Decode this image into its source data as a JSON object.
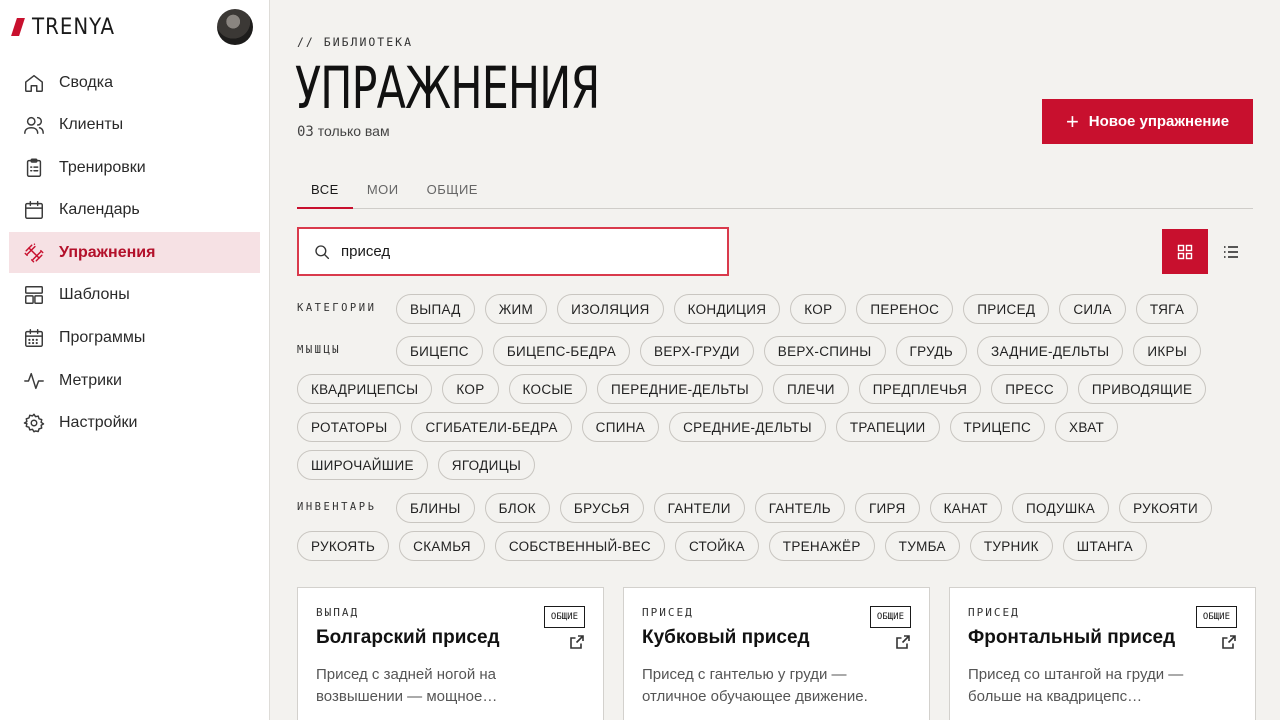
{
  "app": {
    "name": "TRENYA"
  },
  "sidebar": {
    "items": [
      {
        "label": "Сводка",
        "icon": "home-icon"
      },
      {
        "label": "Клиенты",
        "icon": "users-icon"
      },
      {
        "label": "Тренировки",
        "icon": "clipboard-icon"
      },
      {
        "label": "Календарь",
        "icon": "calendar-icon"
      },
      {
        "label": "Упражнения",
        "icon": "dumbbell-icon",
        "active": true
      },
      {
        "label": "Шаблоны",
        "icon": "layout-icon"
      },
      {
        "label": "Программы",
        "icon": "calendar-grid-icon"
      },
      {
        "label": "Метрики",
        "icon": "activity-icon"
      },
      {
        "label": "Настройки",
        "icon": "gear-icon"
      }
    ]
  },
  "header": {
    "eyebrow": "// БИБЛИОТЕКА",
    "title": "УПРАЖНЕНИЯ",
    "count": "03",
    "count_suffix": "только вам",
    "new_button": "Новое упражнение"
  },
  "tabs": [
    {
      "label": "ВСЕ",
      "active": true
    },
    {
      "label": "МОИ"
    },
    {
      "label": "ОБЩИЕ"
    }
  ],
  "search": {
    "value": "присед"
  },
  "filters": {
    "categories_label": "КАТЕГОРИИ",
    "categories": [
      "ВЫПАД",
      "ЖИМ",
      "ИЗОЛЯЦИЯ",
      "КОНДИЦИЯ",
      "КОР",
      "ПЕРЕНОС",
      "ПРИСЕД",
      "СИЛА",
      "ТЯГА"
    ],
    "muscles_label": "МЫШЦЫ",
    "muscles": [
      "БИЦЕПС",
      "БИЦЕПС-БЕДРА",
      "ВЕРХ-ГРУДИ",
      "ВЕРХ-СПИНЫ",
      "ГРУДЬ",
      "ЗАДНИЕ-ДЕЛЬТЫ",
      "ИКРЫ",
      "КВАДРИЦЕПСЫ",
      "КОР",
      "КОСЫЕ",
      "ПЕРЕДНИЕ-ДЕЛЬТЫ",
      "ПЛЕЧИ",
      "ПРЕДПЛЕЧЬЯ",
      "ПРЕСС",
      "ПРИВОДЯЩИЕ",
      "РОТАТОРЫ",
      "СГИБАТЕЛИ-БЕДРА",
      "СПИНА",
      "СРЕДНИЕ-ДЕЛЬТЫ",
      "ТРАПЕЦИИ",
      "ТРИЦЕПС",
      "ХВАТ",
      "ШИРОЧАЙШИЕ",
      "ЯГОДИЦЫ"
    ],
    "equipment_label": "ИНВЕНТАРЬ",
    "equipment": [
      "БЛИНЫ",
      "БЛОК",
      "БРУСЬЯ",
      "ГАНТЕЛИ",
      "ГАНТЕЛЬ",
      "ГИРЯ",
      "КАНАТ",
      "ПОДУШКА",
      "РУКОЯТИ",
      "РУКОЯТЬ",
      "СКАМЬЯ",
      "СОБСТВЕННЫЙ-ВЕС",
      "СТОЙКА",
      "ТРЕНАЖЁР",
      "ТУМБА",
      "ТУРНИК",
      "ШТАНГА"
    ]
  },
  "cards": [
    {
      "category": "ВЫПАД",
      "badge": "ОБЩИЕ",
      "title": "Болгарский присед",
      "desc": "Присед с задней ногой на возвышении — мощное…"
    },
    {
      "category": "ПРИСЕД",
      "badge": "ОБЩИЕ",
      "title": "Кубковый присед",
      "desc": "Присед с гантелью у груди — отличное обучающее движение."
    },
    {
      "category": "ПРИСЕД",
      "badge": "ОБЩИЕ",
      "title": "Фронтальный присед",
      "desc": "Присед со штангой на груди — больше на квадрицепс…"
    }
  ],
  "colors": {
    "accent": "#c8102e",
    "active_bg": "#f6e1e4",
    "page_bg": "#f3f2ef"
  }
}
